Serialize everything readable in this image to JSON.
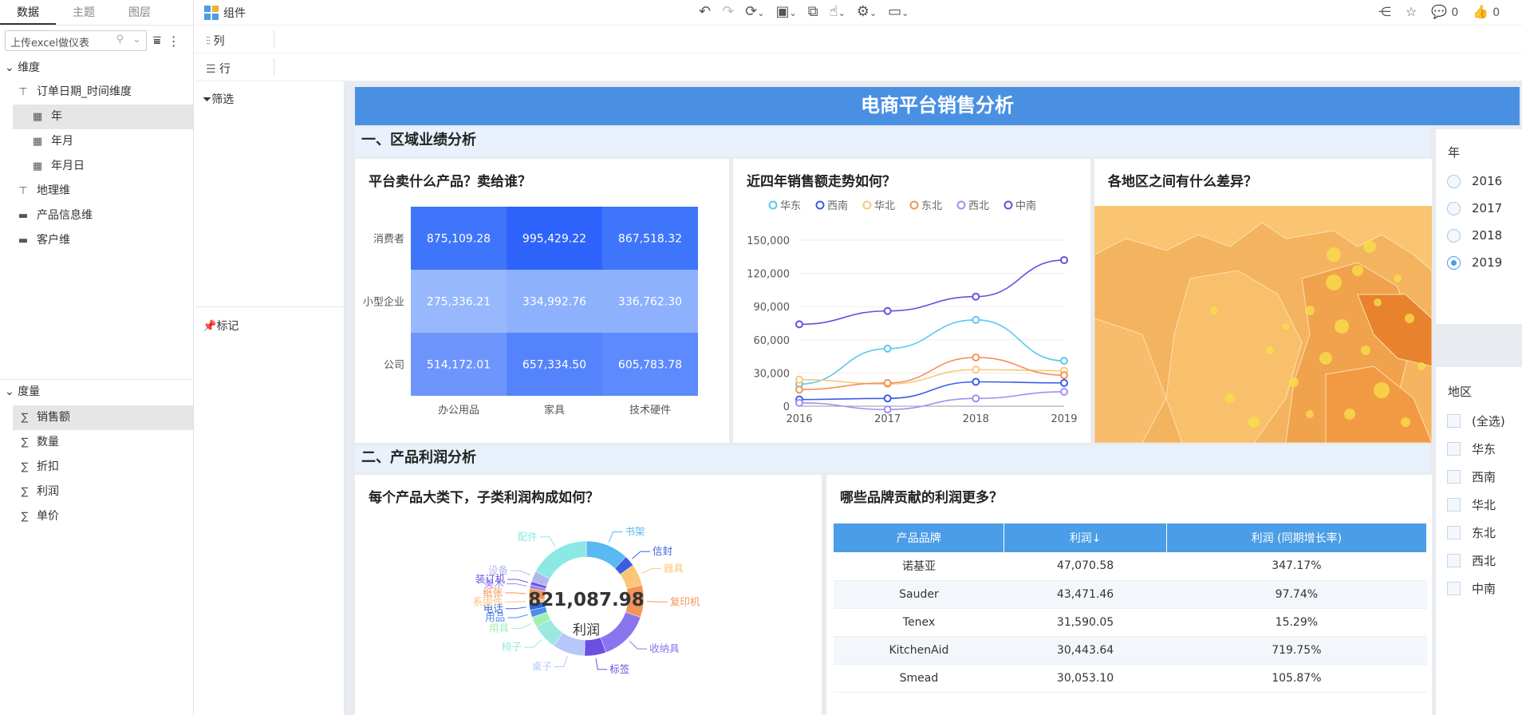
{
  "left_tabs": [
    "数据",
    "主题",
    "图层"
  ],
  "search_placeholder": "上传excel做仪表",
  "dimension_label": "维度",
  "dimensions": [
    {
      "label": "订单日期_时间维度",
      "icon": "hierarchy-icon"
    },
    {
      "label": "年",
      "icon": "date-icon"
    },
    {
      "label": "年月",
      "icon": "date-icon"
    },
    {
      "label": "年月日",
      "icon": "date-icon"
    },
    {
      "label": "地理维",
      "icon": "hierarchy-icon"
    },
    {
      "label": "产品信息维",
      "icon": "folder-icon"
    },
    {
      "label": "客户维",
      "icon": "folder-icon"
    }
  ],
  "measure_label": "度量",
  "measures": [
    "销售额",
    "数量",
    "折扣",
    "利润",
    "单价"
  ],
  "toolbar": {
    "component_label": "组件",
    "comment_count": "0",
    "like_count": "0"
  },
  "shelf": {
    "column_label": "列",
    "row_label": "行",
    "filter_label": "筛选",
    "mark_label": "标记"
  },
  "dashboard": {
    "title": "电商平台销售分析",
    "section1": "一、区域业绩分析",
    "section2": "二、产品利润分析",
    "heatmap_title": "平台卖什么产品？卖给谁？",
    "line_title": "近四年销售额走势如何？",
    "map_title": "各地区之间有什么差异？",
    "donut_title": "每个产品大类下，子类利润构成如何？",
    "table_title": "哪些品牌贡献的利润更多？",
    "donut_center_value": "821,087.98",
    "donut_center_label": "利润"
  },
  "heatmap": {
    "rows": [
      "消费者",
      "小型企业",
      "公司"
    ],
    "cols": [
      "办公用品",
      "家具",
      "技术硬件"
    ],
    "cells": [
      [
        "875,109.28",
        "995,429.22",
        "867,518.32"
      ],
      [
        "275,336.21",
        "334,992.76",
        "336,762.30"
      ],
      [
        "514,172.01",
        "657,334.50",
        "605,783.78"
      ]
    ],
    "colors": [
      [
        "#3f75fa",
        "#2e63fb",
        "#3f75fa"
      ],
      [
        "#97b8fd",
        "#8eb1fd",
        "#8eb1fd"
      ],
      [
        "#6d95fc",
        "#5483fb",
        "#5d8afc"
      ]
    ]
  },
  "chart_data": {
    "type": "line",
    "x": [
      "2016",
      "2017",
      "2018",
      "2019"
    ],
    "ylim": [
      0,
      150000
    ],
    "yticks": [
      "0",
      "30,000",
      "60,000",
      "90,000",
      "120,000",
      "150,000"
    ],
    "legend_position": "top",
    "series": [
      {
        "name": "华东",
        "color": "#5bc8ee",
        "values": [
          20000,
          52000,
          78000,
          41000
        ]
      },
      {
        "name": "西南",
        "color": "#3a5de8",
        "values": [
          6000,
          7000,
          22000,
          21000
        ]
      },
      {
        "name": "华北",
        "color": "#f9c77a",
        "values": [
          24000,
          20000,
          33000,
          32000
        ]
      },
      {
        "name": "东北",
        "color": "#f4925a",
        "values": [
          15000,
          21000,
          44000,
          28000
        ]
      },
      {
        "name": "西北",
        "color": "#a28ef2",
        "values": [
          3000,
          -3000,
          7000,
          13000
        ]
      },
      {
        "name": "中南",
        "color": "#6a4fe0",
        "values": [
          74000,
          86000,
          99000,
          132000
        ]
      }
    ]
  },
  "donut": {
    "labels": [
      "书架",
      "信封",
      "器具",
      "复印机",
      "收纳具",
      "标签",
      "桌子",
      "椅子",
      "用具",
      "用品",
      "电话",
      "系固件",
      "纸张",
      "美术",
      "装订机",
      "设备",
      "配件"
    ],
    "values": [
      12,
      3,
      6,
      9,
      14,
      6,
      9,
      7,
      3,
      2,
      2,
      1,
      3,
      1,
      1,
      3,
      17
    ],
    "colors": [
      "#5ab8f2",
      "#3d5ce0",
      "#fbc679",
      "#f59458",
      "#8a75ef",
      "#6a4fe0",
      "#b5c8f9",
      "#99e9e0",
      "#a3f0b5",
      "#4d8cf0",
      "#2f64dd",
      "#f8c37a",
      "#f49357",
      "#9c84ee",
      "#6e56e5",
      "#b2b7ee",
      "#8ce8e4"
    ]
  },
  "brand_table": {
    "headers": [
      "产品品牌",
      "利润↓",
      "利润 (同期增长率)"
    ],
    "rows": [
      [
        "诺基亚",
        "47,070.58",
        "347.17%"
      ],
      [
        "Sauder",
        "43,471.46",
        "97.74%"
      ],
      [
        "Tenex",
        "31,590.05",
        "15.29%"
      ],
      [
        "KitchenAid",
        "30,443.64",
        "719.75%"
      ],
      [
        "Smead",
        "30,053.10",
        "105.87%"
      ]
    ]
  },
  "year_filter": {
    "label": "年",
    "options": [
      "2016",
      "2017",
      "2018",
      "2019"
    ],
    "selected": "2019"
  },
  "region_filter": {
    "label": "地区",
    "options": [
      "(全选)",
      "华东",
      "西南",
      "华北",
      "东北",
      "西北",
      "中南"
    ]
  }
}
